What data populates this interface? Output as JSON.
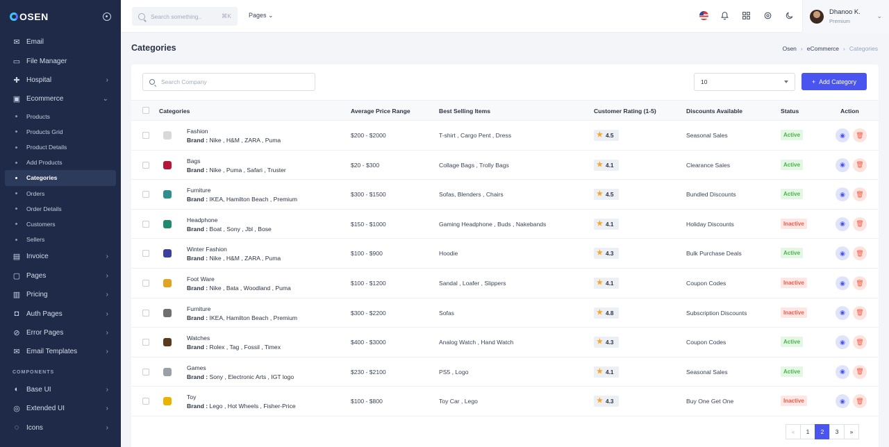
{
  "brand": {
    "name": "OSEN"
  },
  "sidebar": {
    "items_top": [
      {
        "label": "Email",
        "icon": "mail-icon",
        "chevron": false
      },
      {
        "label": "File Manager",
        "icon": "folder-icon",
        "chevron": false
      },
      {
        "label": "Hospital",
        "icon": "hospital-icon",
        "chevron": true
      },
      {
        "label": "Ecommerce",
        "icon": "bag-icon",
        "chevron": true,
        "expanded": true
      }
    ],
    "ecommerce_sub": [
      "Products",
      "Products Grid",
      "Product Details",
      "Add Products",
      "Categories",
      "Orders",
      "Order Details",
      "Customers",
      "Sellers"
    ],
    "active_sub": "Categories",
    "items_mid": [
      {
        "label": "Invoice",
        "icon": "invoice-icon"
      },
      {
        "label": "Pages",
        "icon": "pages-icon"
      },
      {
        "label": "Pricing",
        "icon": "pricing-icon"
      },
      {
        "label": "Auth Pages",
        "icon": "lock-icon"
      },
      {
        "label": "Error Pages",
        "icon": "error-icon"
      },
      {
        "label": "Email Templates",
        "icon": "template-icon"
      }
    ],
    "section_components": "COMPONENTS",
    "items_bottom": [
      {
        "label": "Base UI",
        "icon": "baseui-icon"
      },
      {
        "label": "Extended UI",
        "icon": "extended-icon"
      },
      {
        "label": "Icons",
        "icon": "icons-icon"
      }
    ]
  },
  "topbar": {
    "search_placeholder": "Search something..",
    "search_shortcut": "⌘K",
    "pages_label": "Pages",
    "user_name": "Dhanoo K.",
    "user_role": "Premium"
  },
  "page": {
    "title": "Categories",
    "breadcrumb": [
      "Osen",
      "eCommerce",
      "Categories"
    ]
  },
  "table": {
    "search_placeholder": "Search Company",
    "page_size": "10",
    "add_button": "Add Category",
    "headers": [
      "Categories",
      "Average Price Range",
      "Best Selling Items",
      "Customer Rating (1-5)",
      "Discounts Available",
      "Status",
      "Action"
    ],
    "brand_prefix": "Brand :",
    "rows": [
      {
        "name": "Fashion",
        "brands": "Nike , H&M , ZARA , Puma",
        "price": "$200 - $2000",
        "items": "T-shirt , Cargo Pent , Dress",
        "rating": "4.5",
        "discount": "Seasonal Sales",
        "status": "Active",
        "thumb_color": "#d8d8d8"
      },
      {
        "name": "Bags",
        "brands": "Nike , Puma , Safari , Truster",
        "price": "$20 - $300",
        "items": "Collage Bags , Trolly Bags",
        "rating": "4.1",
        "discount": "Clearance Sales",
        "status": "Active",
        "thumb_color": "#b5173a"
      },
      {
        "name": "Furniture",
        "brands": "IKEA, Hamilton Beach , Premium",
        "price": "$300 - $1500",
        "items": "Sofas, Blenders , Chairs",
        "rating": "4.5",
        "discount": "Bundled Discounts",
        "status": "Active",
        "thumb_color": "#2f8f8f"
      },
      {
        "name": "Headphone",
        "brands": "Boat , Sony , Jbl , Bose",
        "price": "$150 - $1000",
        "items": "Gaming Headphone , Buds , Nakebands",
        "rating": "4.1",
        "discount": "Holiday Discounts",
        "status": "Inactive",
        "thumb_color": "#1f8a6d"
      },
      {
        "name": "Winter Fashion",
        "brands": "Nike , H&M , ZARA , Puma",
        "price": "$100 - $900",
        "items": "Hoodie",
        "rating": "4.3",
        "discount": "Bulk Purchase Deals",
        "status": "Active",
        "thumb_color": "#3b3f9e"
      },
      {
        "name": "Foot Ware",
        "brands": "Nike , Bata , Woodland , Puma",
        "price": "$100 - $1200",
        "items": "Sandal , Loafer , Slippers",
        "rating": "4.1",
        "discount": "Coupon Codes",
        "status": "Inactive",
        "thumb_color": "#e0a520"
      },
      {
        "name": "Furniture",
        "brands": "IKEA, Hamilton Beach , Premium",
        "price": "$300 - $2200",
        "items": "Sofas",
        "rating": "4.8",
        "discount": "Subscription Discounts",
        "status": "Inactive",
        "thumb_color": "#6e6e6e"
      },
      {
        "name": "Watches",
        "brands": "Rolex , Tag , Fossil , Timex",
        "price": "$400 - $3000",
        "items": "Analog Watch , Hand Watch",
        "rating": "4.3",
        "discount": "Coupon Codes",
        "status": "Active",
        "thumb_color": "#5a3a1a"
      },
      {
        "name": "Games",
        "brands": "Sony , Electronic Arts , IGT logo",
        "price": "$230 - $2100",
        "items": "PS5 , Logo",
        "rating": "4.1",
        "discount": "Seasonal Sales",
        "status": "Active",
        "thumb_color": "#9aa0a8"
      },
      {
        "name": "Toy",
        "brands": "Lego , Hot Wheels , Fisher-Price",
        "price": "$100 - $800",
        "items": "Toy Car , Lego",
        "rating": "4.3",
        "discount": "Buy One Get One",
        "status": "Inactive",
        "thumb_color": "#e8b400"
      }
    ]
  },
  "pagination": {
    "prev": "«",
    "pages": [
      "1",
      "2",
      "3"
    ],
    "current": "2",
    "next": "»"
  },
  "colors": {
    "accent": "#4a55f0",
    "sidebar": "#1e2a47",
    "active": "#4ab34a",
    "inactive": "#ef5b45"
  }
}
